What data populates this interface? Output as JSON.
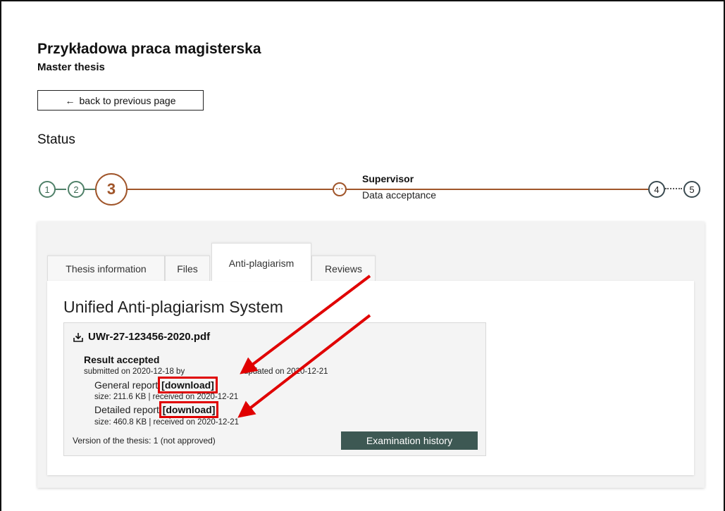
{
  "header": {
    "title": "Przykładowa praca magisterska",
    "subtitle": "Master thesis",
    "back_button": "back to previous page",
    "back_icon": "←"
  },
  "status": {
    "heading": "Status",
    "steps": [
      "1",
      "2",
      "3",
      "4",
      "5"
    ],
    "current_step": "3",
    "substep_icon": "···",
    "substep_role": "Supervisor",
    "substep_name": "Data acceptance"
  },
  "tabs": [
    {
      "label": "Thesis information"
    },
    {
      "label": "Files"
    },
    {
      "label": "Anti-plagiarism",
      "active": true
    },
    {
      "label": "Reviews"
    }
  ],
  "antiplagiarism": {
    "heading": "Unified Anti-plagiarism System",
    "file_name": "UWr-27-123456-2020.pdf",
    "result": "Result accepted",
    "submitted": "submitted on 2020-12-18 by",
    "updated": "updated on 2020-12-21",
    "general_report_label": "General report",
    "general_report_link": "[download]",
    "general_report_meta": "size: 211.6 KB | received on 2020-12-21",
    "detailed_report_label": "Detailed report",
    "detailed_report_link": "[download]",
    "detailed_report_meta": "size: 460.8 KB | received on 2020-12-21",
    "version": "Version of the thesis: 1 (not approved)",
    "history_button": "Examination history"
  },
  "colors": {
    "accent": "#a0552a",
    "done": "#4f8068",
    "button": "#3d5853",
    "annotation": "#e00000"
  }
}
